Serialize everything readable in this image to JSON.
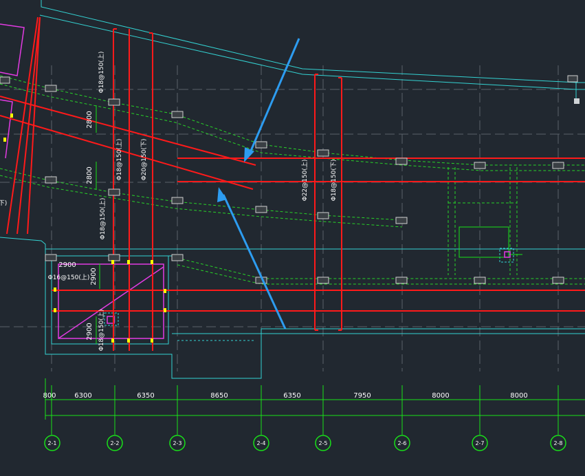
{
  "colors": {
    "background": "#212830",
    "grid": "#5b626a",
    "cyan": "#34d3d3",
    "red": "#ff1a1a",
    "green_solid": "#19e219",
    "green_dash": "#28d428",
    "magenta": "#e33be3",
    "yellow": "#ffff00",
    "arrow": "#2d9cf0",
    "text": "#ffffff"
  },
  "rebar_labels": [
    {
      "id": "r1",
      "text": "Φ18@150(上)"
    },
    {
      "id": "r2",
      "text": "Φ18@150(上)"
    },
    {
      "id": "r3",
      "text": "Φ20@150(下)"
    },
    {
      "id": "r4",
      "text": "Φ18@150(上)"
    },
    {
      "id": "r5",
      "text": "Φ22@150(上)"
    },
    {
      "id": "r6",
      "text": "Φ18@150(下)"
    },
    {
      "id": "r7",
      "text": "Φ16@150(上)"
    },
    {
      "id": "r8",
      "text": "Φ18@150(上)"
    },
    {
      "id": "r9",
      "text": "下)"
    }
  ],
  "local_dimensions": [
    "2800",
    "2800",
    "2900",
    "2900",
    "2900"
  ],
  "bottom_dimensions": [
    "800",
    "6300",
    "6350",
    "8650",
    "6350",
    "7950",
    "8000",
    "8000"
  ],
  "axis_labels": [
    "2-1",
    "2-2",
    "2-3",
    "2-4",
    "2-5",
    "2-6",
    "2-7",
    "2-8"
  ]
}
